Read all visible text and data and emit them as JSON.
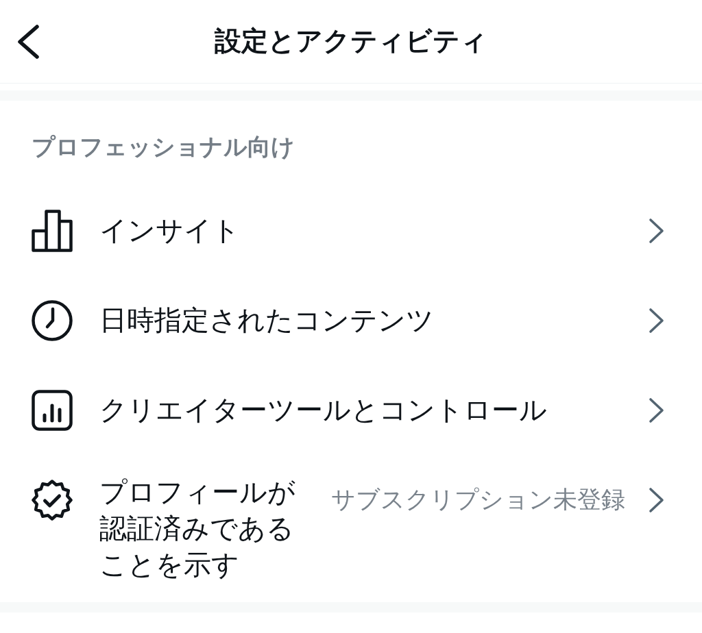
{
  "header": {
    "title": "設定とアクティビティ"
  },
  "section": {
    "heading": "プロフェッショナル向け",
    "items": [
      {
        "kind": "insights",
        "label": "インサイト"
      },
      {
        "kind": "scheduled",
        "label": "日時指定されたコンテンツ"
      },
      {
        "kind": "creator",
        "label": "クリエイターツールとコントロール"
      },
      {
        "kind": "verified",
        "label": "プロフィールが認証済みであることを示す",
        "status": "サブスクリプション未登録"
      }
    ]
  }
}
